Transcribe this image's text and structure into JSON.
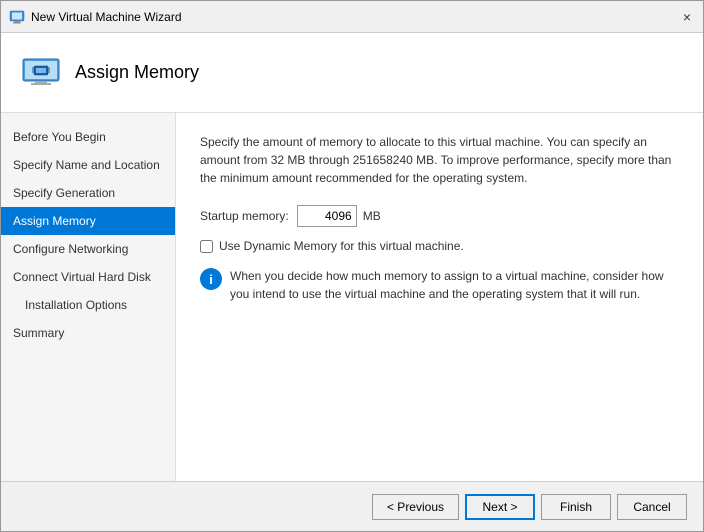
{
  "window": {
    "title": "New Virtual Machine Wizard",
    "close_label": "×"
  },
  "header": {
    "title": "Assign Memory",
    "icon_label": "virtual-machine-icon"
  },
  "sidebar": {
    "items": [
      {
        "label": "Before You Begin",
        "active": false,
        "indent": false
      },
      {
        "label": "Specify Name and Location",
        "active": false,
        "indent": false
      },
      {
        "label": "Specify Generation",
        "active": false,
        "indent": false
      },
      {
        "label": "Assign Memory",
        "active": true,
        "indent": false
      },
      {
        "label": "Configure Networking",
        "active": false,
        "indent": false
      },
      {
        "label": "Connect Virtual Hard Disk",
        "active": false,
        "indent": false
      },
      {
        "label": "Installation Options",
        "active": false,
        "indent": true
      },
      {
        "label": "Summary",
        "active": false,
        "indent": false
      }
    ]
  },
  "main": {
    "description": "Specify the amount of memory to allocate to this virtual machine. You can specify an amount from 32 MB through 251658240 MB. To improve performance, specify more than the minimum amount recommended for the operating system.",
    "startup_memory_label": "Startup memory:",
    "startup_memory_value": "4096",
    "startup_memory_unit": "MB",
    "checkbox_label": "Use Dynamic Memory for this virtual machine.",
    "info_text": "When you decide how much memory to assign to a virtual machine, consider how you intend to use the virtual machine and the operating system that it will run."
  },
  "footer": {
    "previous_label": "< Previous",
    "next_label": "Next >",
    "finish_label": "Finish",
    "cancel_label": "Cancel"
  }
}
